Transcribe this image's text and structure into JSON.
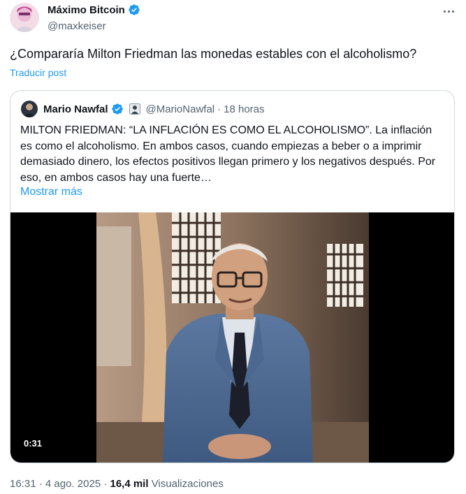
{
  "post": {
    "author_name": "Máximo Bitcoin",
    "author_handle": "@maxkeiser",
    "text": "¿Compararía Milton Friedman las monedas estables con el alcoholismo?",
    "translate_label": "Traducir post",
    "time": "16:31",
    "separator": "·",
    "date": "4 ago. 2025",
    "views_count": "16,4 mil",
    "views_label": "Visualizaciones"
  },
  "quoted": {
    "author_name": "Mario Nawfal",
    "author_handle": "@MarioNawfal",
    "separator": "·",
    "time": "18 horas",
    "text": "MILTON FRIEDMAN: “LA INFLACIÓN ES COMO EL ALCOHOLISMO”. La inflación es como el alcoholismo. En ambos casos, cuando empiezas a beber o a imprimir demasiado dinero, los efectos positivos llegan primero y los negativos después. Por eso, en ambos casos hay una fuerte…",
    "show_more_label": "Mostrar más",
    "video_duration": "0:31"
  },
  "icons": {
    "verified": "verified-badge-icon",
    "more": "more-dots-icon",
    "affiliate": "affiliate-badge-icon"
  },
  "colors": {
    "accent": "#1d9bf0",
    "text": "#0f1419",
    "secondary": "#536471",
    "border": "#cfd9de"
  }
}
